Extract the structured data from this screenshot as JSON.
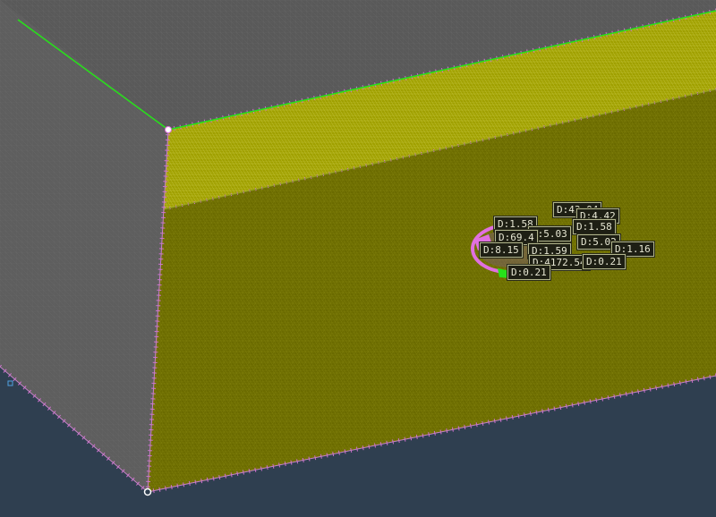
{
  "viewport": {
    "background_color": "#2f3f50",
    "colors": {
      "top_face": "#595959",
      "side_face": "#5e5e5e",
      "rim_face": "#a0a000",
      "front_face": "#6b6b00",
      "feature_edge": "#27e21a",
      "mesh_edge": "#d070d0",
      "selection_highlight": "#e070e0"
    }
  },
  "measurements": [
    "D:43.04",
    "D:4.42",
    "D:1.58",
    "D:1.58",
    "D:5.03",
    "D:69.4",
    "D:5.02",
    "D:8.15",
    "D:4172.54",
    "D:1.59",
    "D:1.16",
    "D:0.21",
    "D:0.21"
  ]
}
